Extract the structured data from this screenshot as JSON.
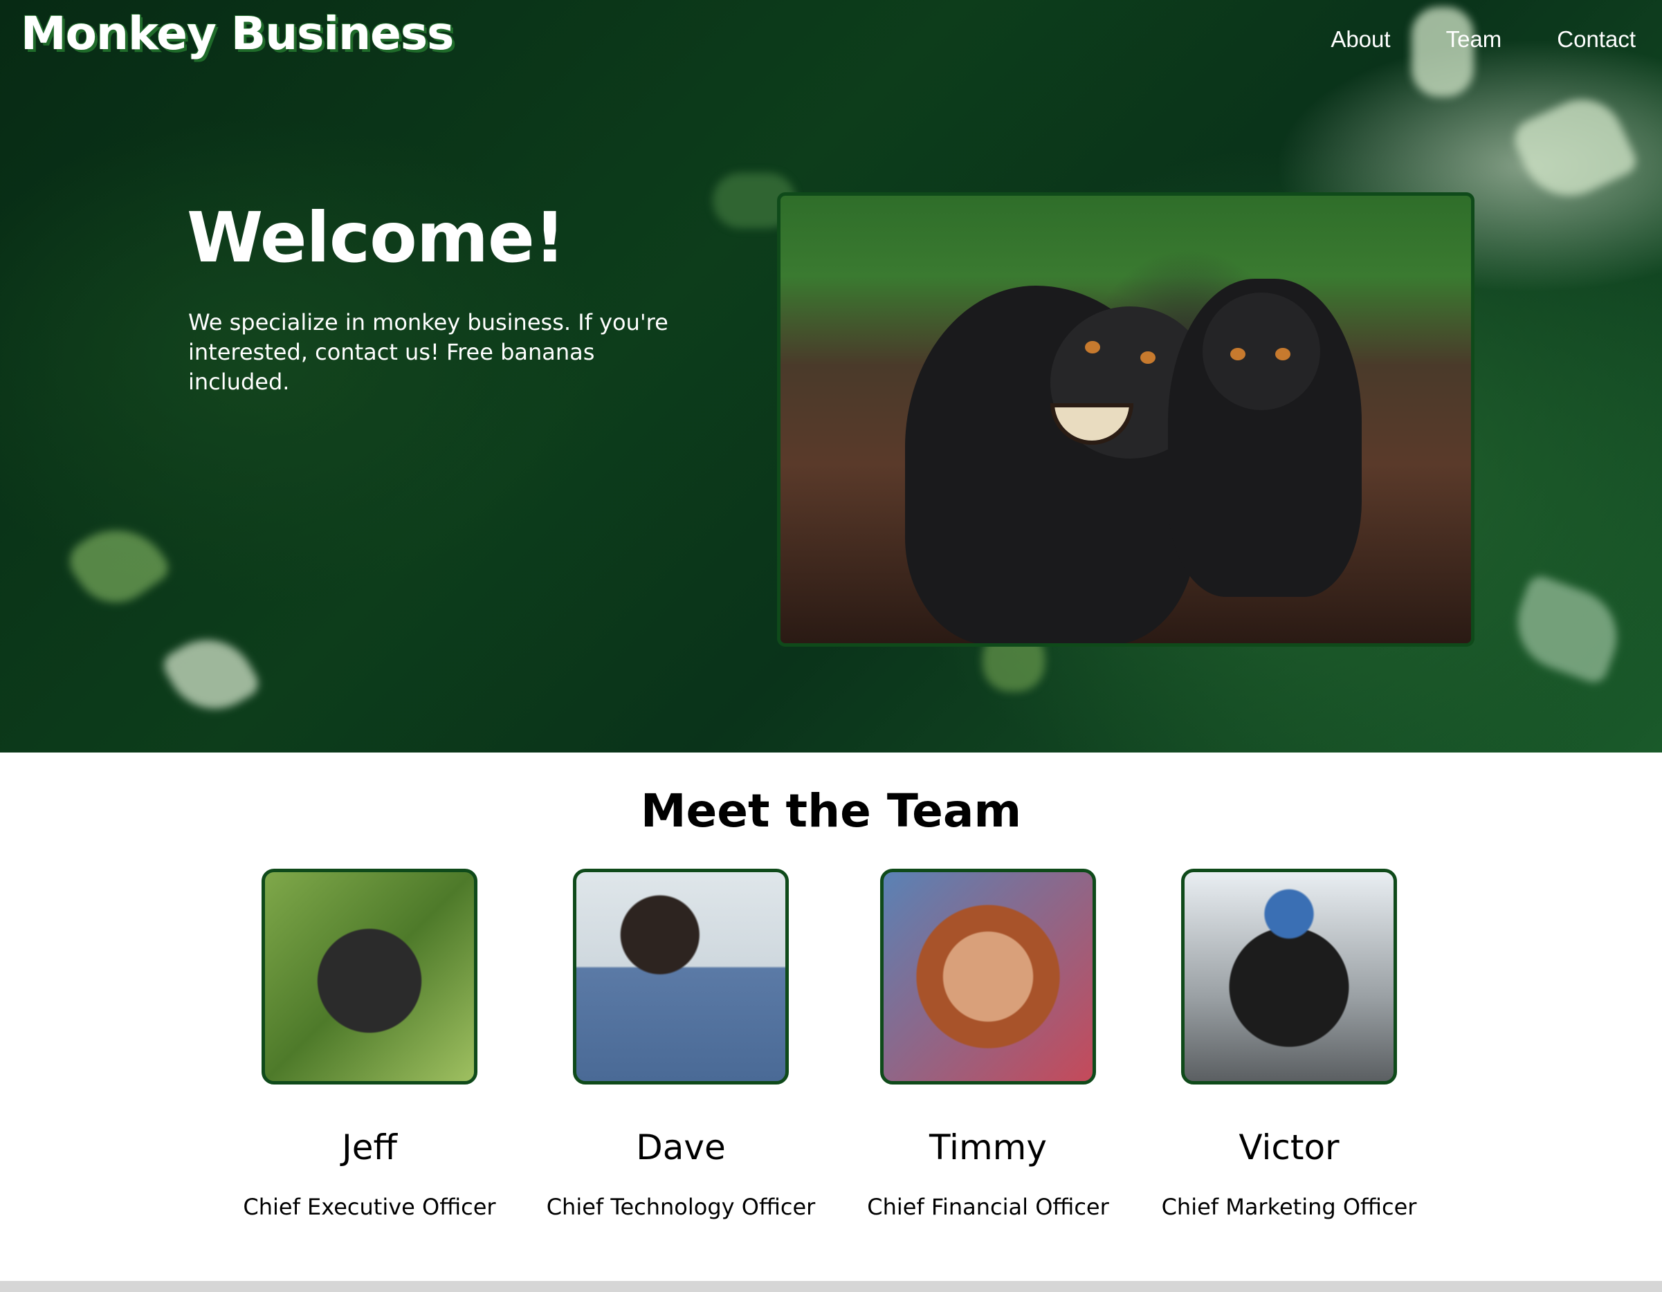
{
  "site": {
    "logo_text": "Monkey Business",
    "nav": [
      {
        "label": "About"
      },
      {
        "label": "Team"
      },
      {
        "label": "Contact"
      }
    ]
  },
  "hero": {
    "heading": "Welcome!",
    "intro": "We specialize in monkey business. If you're interested, contact us! Free bananas included.",
    "image_subject": "two macaque monkeys in a forest"
  },
  "team": {
    "heading": "Meet the Team",
    "members": [
      {
        "name": "Jeff",
        "role": "Chief Executive Officer"
      },
      {
        "name": "Dave",
        "role": "Chief Technology Officer"
      },
      {
        "name": "Timmy",
        "role": "Chief Financial Officer"
      },
      {
        "name": "Victor",
        "role": "Chief Marketing Officer"
      }
    ]
  },
  "colors": {
    "hero_green": "#0d3d1b",
    "photo_border": "#0f4a1a",
    "logo_shadow": "#1f6b2a"
  }
}
